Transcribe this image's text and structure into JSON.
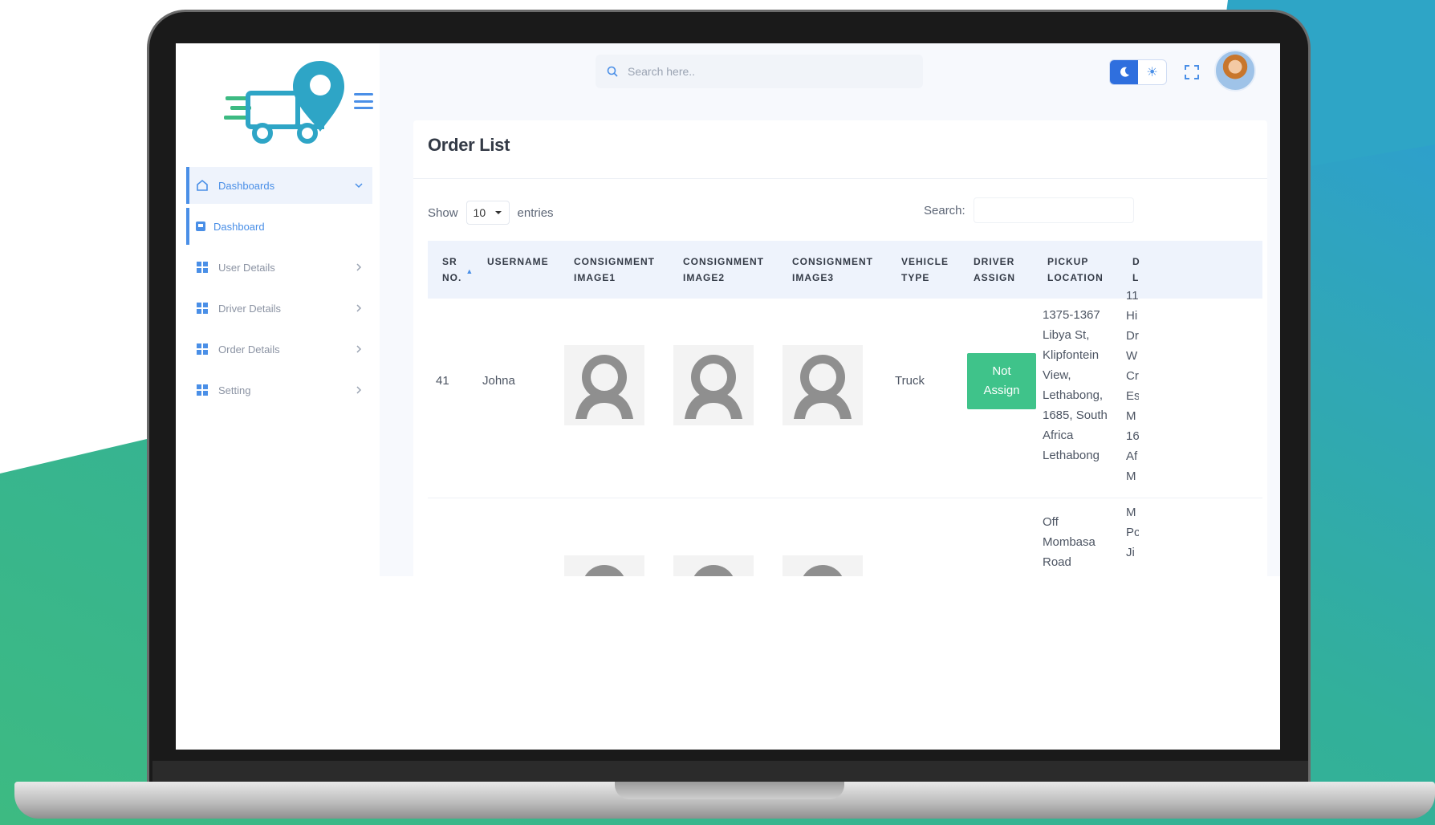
{
  "colors": {
    "accent": "#4a8fe7",
    "badge_green": "#3fc38a",
    "bg_teal": "#2ea5c6",
    "bg_green": "#3dba82"
  },
  "topbar": {
    "search_placeholder": "Search here..",
    "theme_moon_icon": "moon-icon",
    "theme_sun_icon": "sun-icon",
    "sun_glyph": "☀"
  },
  "sidebar": {
    "items": [
      {
        "label": "Dashboards",
        "icon": "home-icon"
      },
      {
        "label": "Dashboard",
        "icon": "dashboard-icon"
      },
      {
        "label": "User Details",
        "icon": "grid-icon"
      },
      {
        "label": "Driver Details",
        "icon": "grid-icon"
      },
      {
        "label": "Order Details",
        "icon": "grid-icon"
      },
      {
        "label": "Setting",
        "icon": "grid-icon"
      }
    ]
  },
  "card": {
    "title": "Order List",
    "show_label": "Show",
    "entries_value": "10",
    "entries_label": "entries",
    "search_label": "Search:"
  },
  "table": {
    "headers": [
      "SR NO.",
      "USERNAME",
      "CONSIGNMENT IMAGE1",
      "CONSIGNMENT IMAGE2",
      "CONSIGNMENT IMAGE3",
      "VEHICLE TYPE",
      "DRIVER ASSIGN",
      "PICKUP LOCATION",
      "D L"
    ],
    "header_lines": [
      [
        "SR",
        "NO."
      ],
      [
        "",
        "USERNAME"
      ],
      [
        "CONSIGNMENT",
        "IMAGE1"
      ],
      [
        "CONSIGNMENT",
        "IMAGE2"
      ],
      [
        "CONSIGNMENT",
        "IMAGE3"
      ],
      [
        "VEHICLE",
        "TYPE"
      ],
      [
        "DRIVER",
        "ASSIGN"
      ],
      [
        "PICKUP",
        "LOCATION"
      ],
      [
        "D",
        "L"
      ]
    ],
    "rows": [
      {
        "sr_no": "41",
        "username": "Johna",
        "vehicle_type": "Truck",
        "driver_assign": [
          "Not",
          "Assign"
        ],
        "pickup_location": [
          "1375-1367",
          "Libya St,",
          "Klipfontein",
          "View,",
          "Lethabong,",
          "1685, South",
          "Africa",
          "Lethabong"
        ],
        "drop_location_cut": [
          "11;",
          "Hi",
          "Dr",
          "W",
          "Cr",
          "Es",
          "M",
          "16",
          "Af",
          "M"
        ]
      },
      {
        "pickup_location": [
          "Off",
          "Mombasa",
          "Road"
        ],
        "drop_location_cut": [
          "M",
          "Pc",
          "Ji"
        ]
      }
    ]
  }
}
